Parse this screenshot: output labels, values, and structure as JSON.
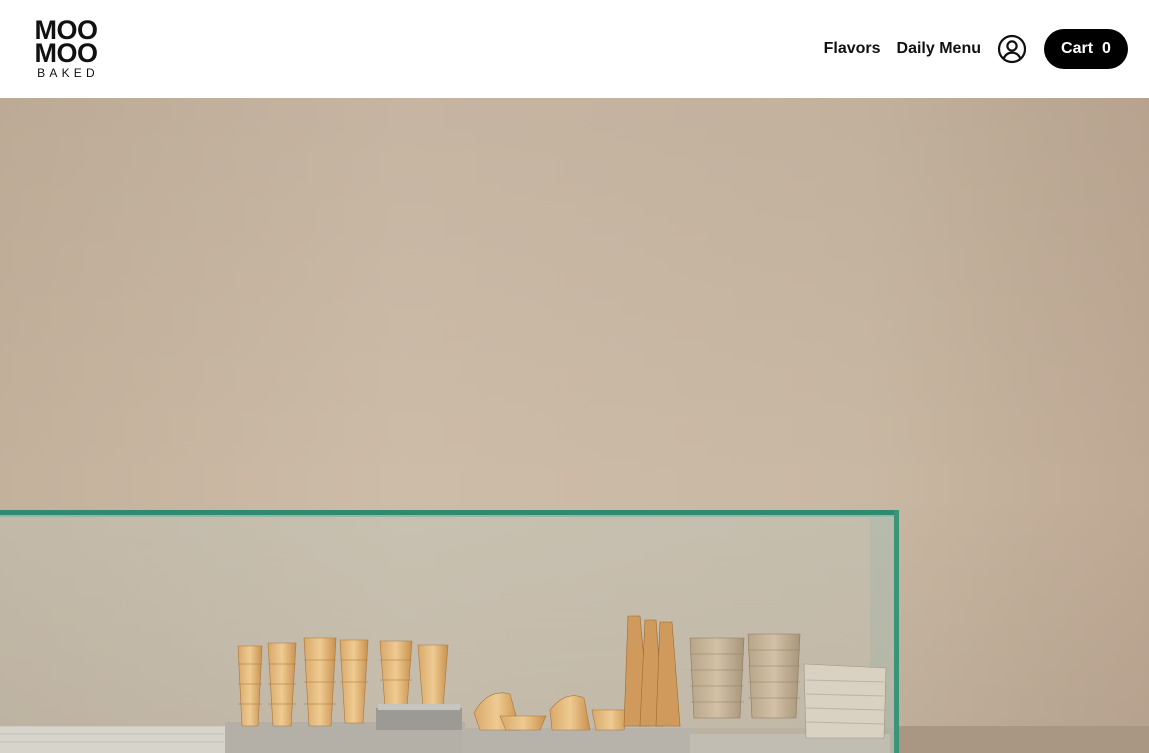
{
  "brand": {
    "line1": "MOO",
    "line2": "MOO",
    "sub": "BAKED"
  },
  "nav": {
    "links": [
      {
        "label": "Flavors"
      },
      {
        "label": "Daily Menu"
      }
    ],
    "cart_label": "Cart",
    "cart_count": "0"
  },
  "colors": {
    "header_bg": "#ffffff",
    "cart_bg": "#000000",
    "wall": "#c7b7a3",
    "glass_edge": "#2f8a70"
  },
  "icons": {
    "account": "user-circle-icon"
  },
  "hero": {
    "image": "ice cream shop counter with stacked waffle cones and cups behind a glass display"
  }
}
